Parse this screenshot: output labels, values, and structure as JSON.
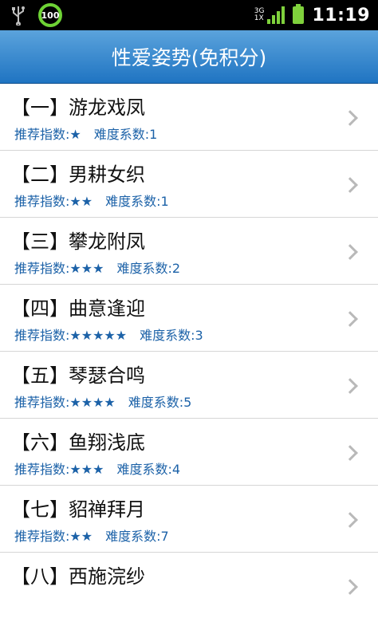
{
  "status_bar": {
    "battery_level": "100",
    "network": "3G",
    "network2": "1X",
    "time": "11:19"
  },
  "header": {
    "title": "性爱姿势(免积分)"
  },
  "list_items": [
    {
      "title": "【一】游龙戏凤",
      "recommend": "推荐指数:★",
      "difficulty": "难度系数:1"
    },
    {
      "title": "【二】男耕女织",
      "recommend": "推荐指数:★★",
      "difficulty": "难度系数:1"
    },
    {
      "title": "【三】攀龙附凤",
      "recommend": "推荐指数:★★★",
      "difficulty": "难度系数:2"
    },
    {
      "title": "【四】曲意逢迎",
      "recommend": "推荐指数:★★★★★",
      "difficulty": "难度系数:3"
    },
    {
      "title": "【五】琴瑟合鸣",
      "recommend": "推荐指数:★★★★",
      "difficulty": "难度系数:5"
    },
    {
      "title": "【六】鱼翔浅底",
      "recommend": "推荐指数:★★★",
      "difficulty": "难度系数:4"
    },
    {
      "title": "【七】貂禅拜月",
      "recommend": "推荐指数:★★",
      "difficulty": "难度系数:7"
    },
    {
      "title": "【八】西施浣纱",
      "recommend": "",
      "difficulty": ""
    }
  ],
  "colors": {
    "header_top": "#5ba3dc",
    "header_bottom": "#1f74c2",
    "subtitle": "#1c62a8",
    "battery_green": "#6ed335"
  },
  "icons": {
    "usb": "usb-icon",
    "signal": "signal-icon",
    "battery": "battery-icon",
    "chevron": "chevron-right-icon"
  }
}
